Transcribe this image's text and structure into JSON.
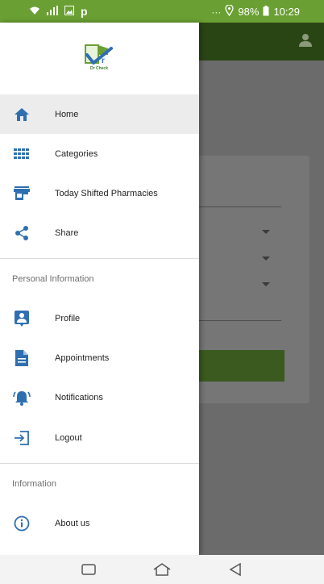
{
  "status_bar": {
    "battery": "98%",
    "time": "10:29",
    "bg_color": "#6aa033",
    "icons": [
      "wifi-icon",
      "signal-icon",
      "gallery-icon",
      "pinterest-icon",
      "more-icon",
      "location-icon"
    ]
  },
  "logo": {
    "text": "Dr Check"
  },
  "drawer": {
    "main_items": [
      {
        "label": "Home",
        "icon": "home-icon",
        "active": true
      },
      {
        "label": "Categories",
        "icon": "grid-icon",
        "active": false
      },
      {
        "label": "Today Shifted Pharmacies",
        "icon": "store-icon",
        "active": false
      },
      {
        "label": "Share",
        "icon": "share-icon",
        "active": false
      }
    ],
    "personal_title": "Personal Information",
    "personal_items": [
      {
        "label": "Profile",
        "icon": "profile-icon"
      },
      {
        "label": "Appointments",
        "icon": "document-icon"
      },
      {
        "label": "Notifications",
        "icon": "bell-icon"
      },
      {
        "label": "Logout",
        "icon": "logout-icon"
      }
    ],
    "info_title": "Information",
    "info_items": [
      {
        "label": "About us",
        "icon": "info-icon"
      }
    ]
  },
  "colors": {
    "accent": "#2f6fb0",
    "brand_green": "#6aa033",
    "app_header": "#2a4514"
  }
}
